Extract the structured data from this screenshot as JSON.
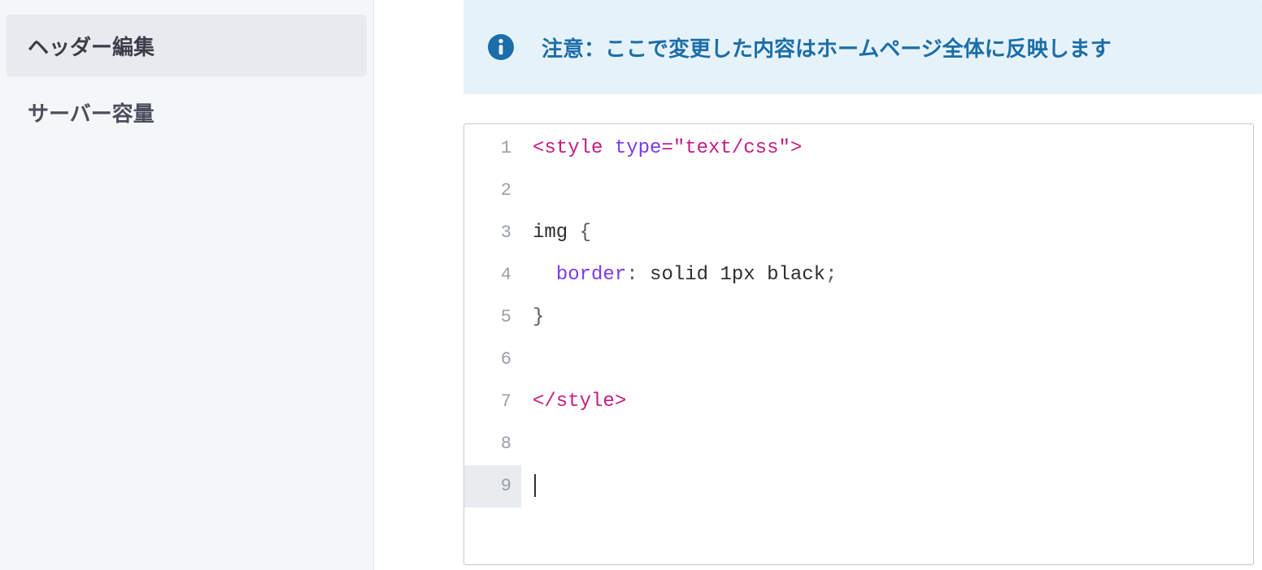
{
  "sidebar": {
    "items": [
      {
        "label": "ヘッダー編集",
        "active": true
      },
      {
        "label": "サーバー容量",
        "active": false
      }
    ]
  },
  "alert": {
    "icon": "info-circle-icon",
    "text": "注意：ここで変更した内容はホームページ全体に反映します"
  },
  "editor": {
    "current_line": 9,
    "lines": [
      {
        "n": 1,
        "tokens": [
          {
            "t": "<style ",
            "c": "tok-tag"
          },
          {
            "t": "type",
            "c": "tok-attr"
          },
          {
            "t": "=",
            "c": "tok-tag"
          },
          {
            "t": "\"text/css\"",
            "c": "tok-str"
          },
          {
            "t": ">",
            "c": "tok-tag"
          }
        ]
      },
      {
        "n": 2,
        "tokens": []
      },
      {
        "n": 3,
        "tokens": [
          {
            "t": "img ",
            "c": "tok-sel"
          },
          {
            "t": "{",
            "c": "tok-punc"
          }
        ]
      },
      {
        "n": 4,
        "tokens": [
          {
            "t": "  ",
            "c": "tok-val"
          },
          {
            "t": "border",
            "c": "tok-prop"
          },
          {
            "t": ": ",
            "c": "tok-punc"
          },
          {
            "t": "solid 1px black",
            "c": "tok-val"
          },
          {
            "t": ";",
            "c": "tok-punc"
          }
        ]
      },
      {
        "n": 5,
        "tokens": [
          {
            "t": "}",
            "c": "tok-punc"
          }
        ]
      },
      {
        "n": 6,
        "tokens": []
      },
      {
        "n": 7,
        "tokens": [
          {
            "t": "</style>",
            "c": "tok-tag"
          }
        ]
      },
      {
        "n": 8,
        "tokens": []
      },
      {
        "n": 9,
        "tokens": []
      }
    ]
  }
}
